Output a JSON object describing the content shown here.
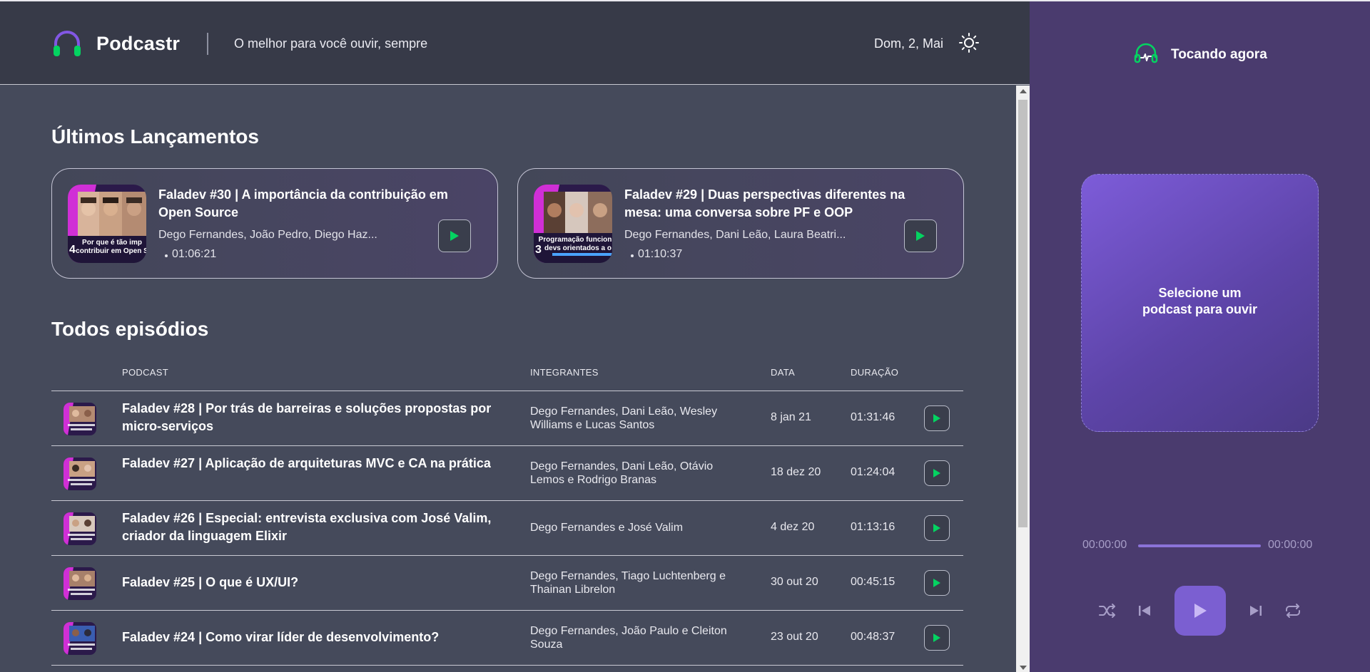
{
  "header": {
    "brand": "Podcastr",
    "tagline": "O melhor para você ouvir, sempre",
    "date": "Dom, 2, Mai",
    "logo_icon": "headphones-icon",
    "theme_icon": "sun-icon"
  },
  "latest": {
    "title": "Últimos Lançamentos",
    "items": [
      {
        "title": "Faladev #30 | A importância da contribuição em Open Source",
        "members": "Dego Fernandes, João Pedro, Diego Haz...",
        "duration": "01:06:21",
        "thumb_caption": "Por que é tão imp contribuir em Open S",
        "thumb_number": "4"
      },
      {
        "title": "Faladev #29 | Duas perspectivas diferentes na mesa: uma conversa sobre PF e OOP",
        "members": "Dego Fernandes, Dani Leão, Laura Beatri...",
        "duration": "01:10:37",
        "thumb_caption": "Programação funcion devs orientados a o",
        "thumb_number": "3"
      }
    ]
  },
  "all": {
    "title": "Todos episódios",
    "columns": {
      "podcast": "PODCAST",
      "members": "INTEGRANTES",
      "date": "DATA",
      "duration": "DURAÇÃO"
    },
    "rows": [
      {
        "title": "Faladev #28 | Por trás de barreiras e soluções propostas por micro-serviços",
        "members": "Dego Fernandes, Dani Leão, Wesley Williams e Lucas Santos",
        "date": "8 jan 21",
        "duration": "01:31:46"
      },
      {
        "title": "Faladev #27 | Aplicação de arquiteturas MVC e CA na prática",
        "members": "Dego Fernandes, Dani Leão, Otávio Lemos e Rodrigo Branas",
        "date": "18 dez 20",
        "duration": "01:24:04"
      },
      {
        "title": "Faladev #26 | Especial: entrevista exclusiva com José Valim, criador da linguagem Elixir",
        "members": "Dego Fernandes e José Valim",
        "date": "4 dez 20",
        "duration": "01:13:16"
      },
      {
        "title": "Faladev #25 | O que é UX/UI?",
        "members": "Dego Fernandes, Tiago Luchtenberg e Thainan Librelon",
        "date": "30 out 20",
        "duration": "00:45:15"
      },
      {
        "title": "Faladev #24 | Como virar líder de desenvolvimento?",
        "members": "Dego Fernandes, João Paulo e Cleiton Souza",
        "date": "23 out 20",
        "duration": "00:48:37"
      }
    ]
  },
  "player": {
    "label": "Tocando agora",
    "empty": "Selecione um\npodcast para ouvir",
    "time_start": "00:00:00",
    "time_end": "00:00:00",
    "progress": 0,
    "controls": [
      "shuffle-icon",
      "previous-icon",
      "play-icon",
      "next-icon",
      "repeat-icon"
    ]
  },
  "colors": {
    "accent_green": "#04d361",
    "purple": "#8257e5",
    "player_bg": "#4a3b6e"
  }
}
